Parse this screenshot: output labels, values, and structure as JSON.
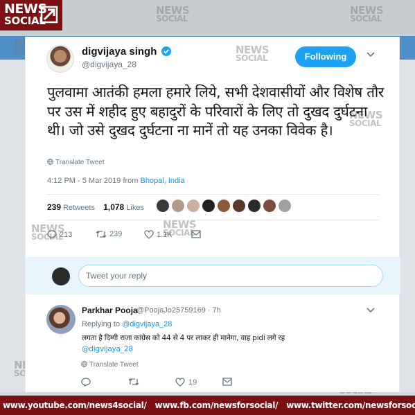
{
  "watermark": {
    "line1": "NEWS",
    "line2": "SOCIAL"
  },
  "logo": {
    "line1": "NEWS",
    "line2": "SOCIAL"
  },
  "tweet": {
    "author_name": "digvijaya singh",
    "author_handle": "@digvijaya_28",
    "follow_label": "Following",
    "text": "पुलवामा आतंकी हमला हमारे लिये, सभी देशवासीयों और विशेष तौर पर उस में शहीद हुए बहादुरों के परिवारों के लिए तो दुखद दुर्घटना थी। जो उसे दुखद दुर्घटना ना मानें तो यह उनका विवेक है।",
    "translate_label": "Translate Tweet",
    "time": "4:12 PM - 5 Mar 2019 from ",
    "location": "Bhopal, India",
    "retweets_count": "239",
    "retweets_label": "Retweets",
    "likes_count": "1,078",
    "likes_label": "Likes",
    "reply_count": "213",
    "retweet_action_count": "239",
    "like_action_count": "1.1K"
  },
  "reply_box": {
    "placeholder": "Tweet your reply"
  },
  "reply": {
    "name": "Parkhar Pooja",
    "handle": "@PoojaJo25759169 · 7h",
    "replying_to_label": "Replying to ",
    "replying_to_handle": "@digvijaya_28",
    "text": "लगता है दिग्गी राजा कांग्रेस को 44 से 4 पर लाकर ही मानेगा, वाह pidi लगे रह",
    "text_mention": "@digvijaya_28",
    "translate_label": "Translate Tweet",
    "like_count": "19"
  },
  "bottom_bar": {
    "youtube": "www.youtube.com/news4social/",
    "facebook": "www.fb.com/newsforsocial/",
    "twitter": "www.twitter.com/newsforsocial/"
  },
  "colors": {
    "brand": "#7b1113",
    "twitter_blue": "#1da1f2",
    "link": "#1b95e0"
  }
}
